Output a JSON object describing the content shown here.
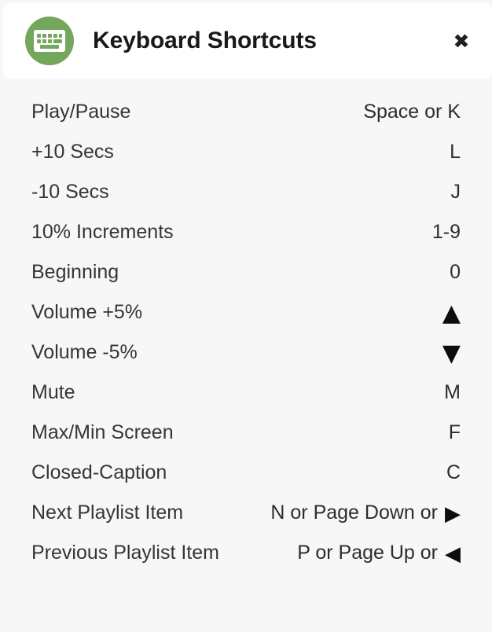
{
  "header": {
    "title": "Keyboard Shortcuts",
    "icon": "keyboard-icon",
    "close_label": "✖",
    "badge_color": "#74a65c",
    "background": "#ffffff"
  },
  "page": {
    "background": "#f7f7f7",
    "text_color": "#333537"
  },
  "shortcuts": [
    {
      "action": "Play/Pause",
      "keys": "Space or K",
      "glyph": ""
    },
    {
      "action": "+10 Secs",
      "keys": "L",
      "glyph": ""
    },
    {
      "action": "-10 Secs",
      "keys": "J",
      "glyph": ""
    },
    {
      "action": "10% Increments",
      "keys": "1-9",
      "glyph": ""
    },
    {
      "action": "Beginning",
      "keys": "0",
      "glyph": ""
    },
    {
      "action": "Volume +5%",
      "keys": "",
      "glyph": "▲"
    },
    {
      "action": "Volume -5%",
      "keys": "",
      "glyph": "▼"
    },
    {
      "action": "Mute",
      "keys": "M",
      "glyph": ""
    },
    {
      "action": "Max/Min Screen",
      "keys": "F",
      "glyph": ""
    },
    {
      "action": "Closed-Caption",
      "keys": "C",
      "glyph": ""
    },
    {
      "action": "Next Playlist Item",
      "keys": "N or Page Down or",
      "glyph": "▶"
    },
    {
      "action": "Previous Playlist Item",
      "keys": "P or Page Up or",
      "glyph": "◀"
    }
  ]
}
